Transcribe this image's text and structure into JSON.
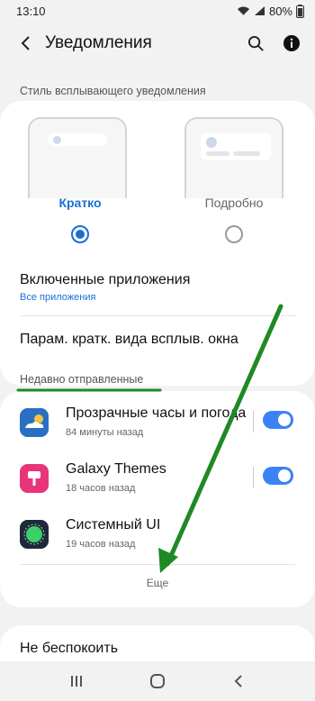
{
  "status": {
    "time": "13:10",
    "battery": "80%"
  },
  "header": {
    "title": "Уведомления"
  },
  "popup_style": {
    "section_label": "Стиль всплывающего уведомления",
    "brief_label": "Кратко",
    "detail_label": "Подробно",
    "selected": "brief"
  },
  "settings": {
    "enabled_apps_title": "Включенные приложения",
    "enabled_apps_sub": "Все приложения",
    "brief_params": "Парам. кратк. вида всплыв. окна"
  },
  "recent": {
    "section_label": "Недавно отправленные",
    "apps": [
      {
        "name": "Прозрачные часы и погода",
        "time": "84 минуты назад",
        "icon": "weather-clock-icon",
        "enabled": true,
        "icon_color": "#2b6fc4"
      },
      {
        "name": "Galaxy Themes",
        "time": "18 часов назад",
        "icon": "galaxy-themes-icon",
        "enabled": true,
        "icon_color": "#e8357a"
      },
      {
        "name": "Системный UI",
        "time": "19 часов назад",
        "icon": "system-ui-icon",
        "enabled": false,
        "icon_color": "#1e2a3a"
      }
    ],
    "more_label": "Еще"
  },
  "dnd": {
    "title": "Не беспокоить"
  },
  "colors": {
    "accent": "#1a6fd6",
    "toggle": "#3b82f6",
    "annotation": "#1f8a23"
  }
}
